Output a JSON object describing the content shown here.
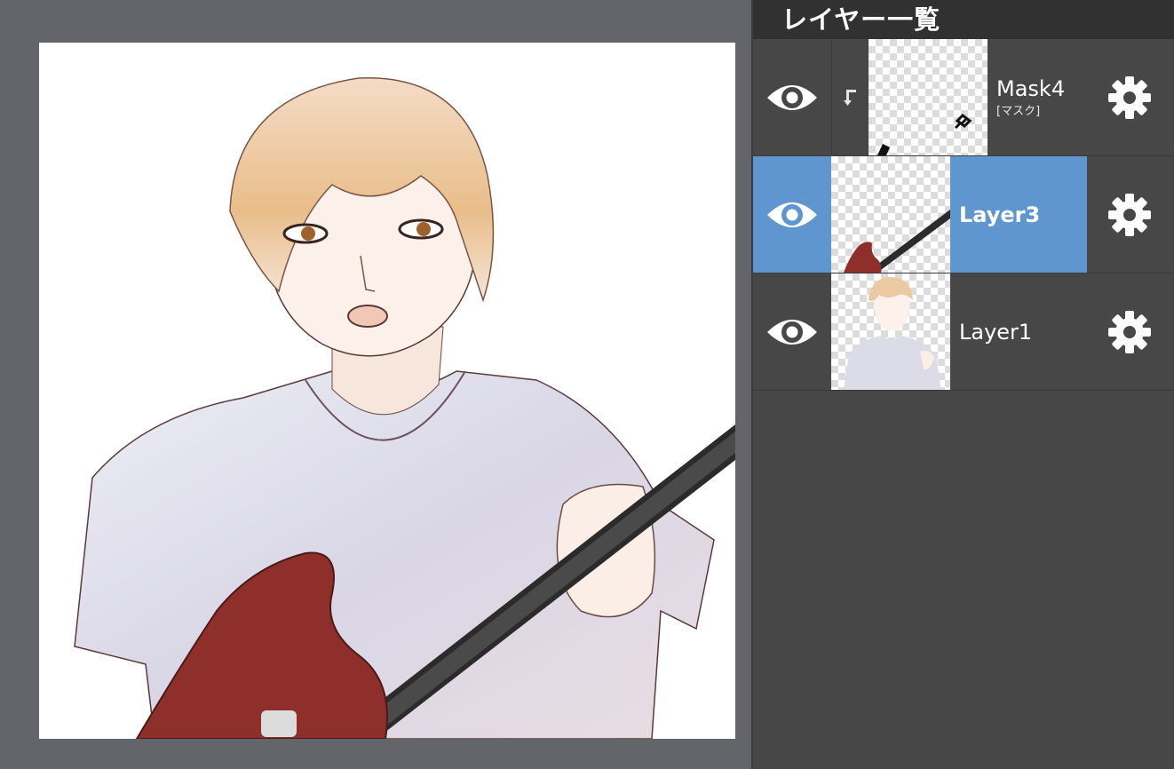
{
  "panel": {
    "title": "レイヤー一覧"
  },
  "layers": [
    {
      "name": "Mask4",
      "subtitle": "[マスク]",
      "visible": true,
      "selected": false,
      "clipped": true
    },
    {
      "name": "Layer3",
      "subtitle": "",
      "visible": true,
      "selected": true,
      "clipped": false
    },
    {
      "name": "Layer1",
      "subtitle": "",
      "visible": true,
      "selected": false,
      "clipped": false
    }
  ],
  "colors": {
    "selected": "#6096cf",
    "panel_bg": "#474747",
    "header_bg": "#313131",
    "workspace_bg": "#63656a",
    "guitar_body": "#8e2f2b"
  },
  "icons": {
    "visibility": "eye-icon",
    "settings": "gear-icon",
    "clip": "clip-arrow-icon"
  }
}
